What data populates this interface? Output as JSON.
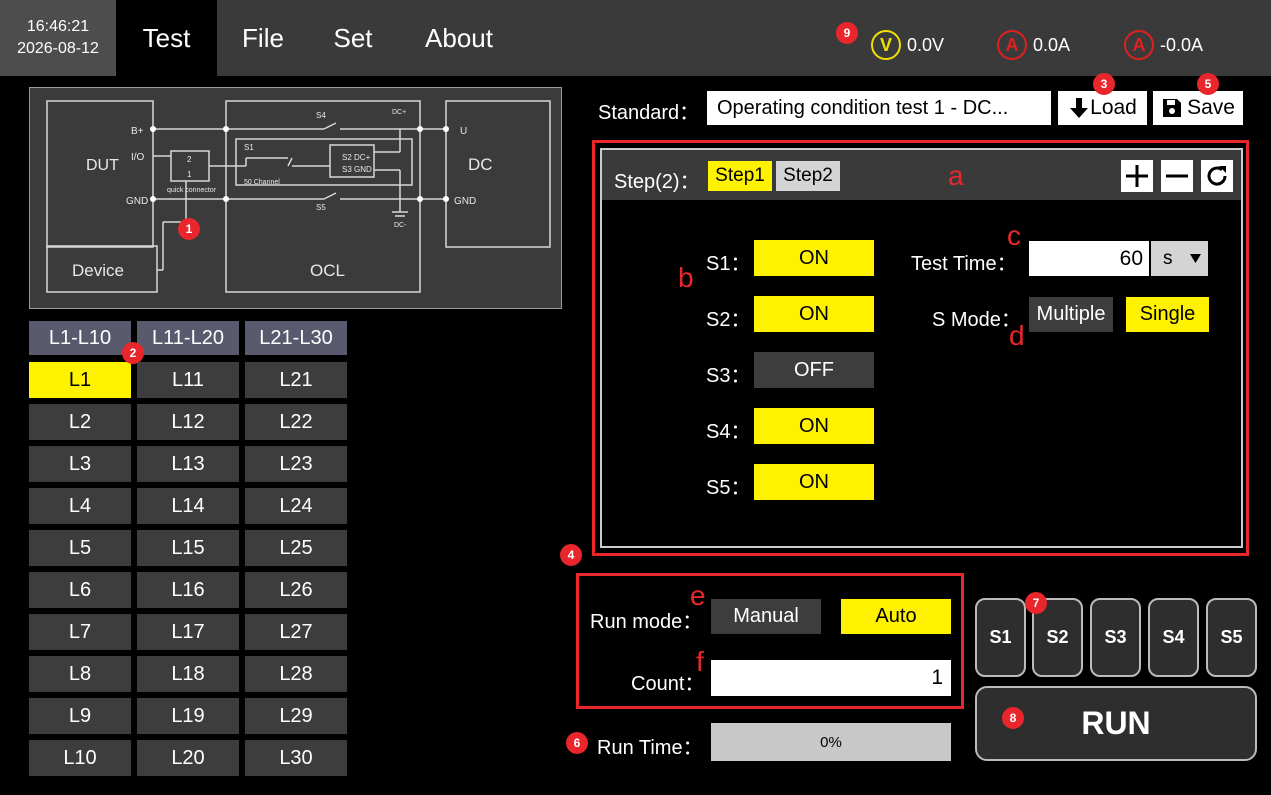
{
  "header": {
    "time": "16:46:21",
    "date": "2026-08-12",
    "menu": [
      "Test",
      "File",
      "Set",
      "About"
    ],
    "meters": {
      "voltage": {
        "symbol": "V",
        "value": "0.0V",
        "color": "#f0e000"
      },
      "current1": {
        "symbol": "A",
        "value": "0.0A",
        "color": "#e02020"
      },
      "current2": {
        "symbol": "A",
        "value": "-0.0A",
        "color": "#e02020"
      }
    }
  },
  "diagram": {
    "dut": "DUT",
    "device": "Device",
    "ocl": "OCL",
    "dc": "DC",
    "bplus": "B+",
    "io": "I/O",
    "gnd_left": "GND",
    "connector_top": "2",
    "connector_bottom": "1",
    "connector_label": "quick connector",
    "s1": "S1",
    "s2": "S2 DC+",
    "s3": "S3 GND",
    "s4": "S4",
    "s5": "S5",
    "channel": "50 Channel",
    "dcplus": "DC+",
    "dcminus": "DC-",
    "u": "U",
    "gnd_right": "GND"
  },
  "levels": {
    "tabs": [
      "L1-L10",
      "L11-L20",
      "L21-L30"
    ],
    "col1": [
      "L1",
      "L2",
      "L3",
      "L4",
      "L5",
      "L6",
      "L7",
      "L8",
      "L9",
      "L10"
    ],
    "col2": [
      "L11",
      "L12",
      "L13",
      "L14",
      "L15",
      "L16",
      "L17",
      "L18",
      "L19",
      "L20"
    ],
    "col3": [
      "L21",
      "L22",
      "L23",
      "L24",
      "L25",
      "L26",
      "L27",
      "L28",
      "L29",
      "L30"
    ],
    "selected": "L1"
  },
  "standard": {
    "label": "Standard：",
    "value": "Operating condition test 1 - DC...",
    "load": "Load",
    "save": "Save"
  },
  "steps": {
    "label": "Step(2)：",
    "tabs": [
      "Step1",
      "Step2"
    ],
    "selected": "Step1",
    "switches": [
      {
        "label": "S1：",
        "state": "ON"
      },
      {
        "label": "S2：",
        "state": "ON"
      },
      {
        "label": "S3：",
        "state": "OFF"
      },
      {
        "label": "S4：",
        "state": "ON"
      },
      {
        "label": "S5：",
        "state": "ON"
      }
    ],
    "test_time_label": "Test Time：",
    "test_time_value": "60",
    "test_time_unit": "s",
    "s_mode_label": "S Mode：",
    "s_mode_options": [
      "Multiple",
      "Single"
    ],
    "s_mode_selected": "Single"
  },
  "run": {
    "mode_label": "Run mode：",
    "modes": [
      "Manual",
      "Auto"
    ],
    "mode_selected": "Auto",
    "count_label": "Count：",
    "count_value": "1",
    "time_label": "Run Time：",
    "progress_text": "0%",
    "progress": 0
  },
  "channels": [
    "S1",
    "S2",
    "S3",
    "S4",
    "S5"
  ],
  "run_button": "RUN",
  "annotations": {
    "badges": [
      "1",
      "2",
      "3",
      "4",
      "5",
      "6",
      "7",
      "8",
      "9"
    ],
    "letters": [
      "a",
      "b",
      "c",
      "d",
      "e",
      "f"
    ]
  },
  "colors": {
    "accent_yellow": "#fff200",
    "annotation_red": "#e8262b",
    "topbar": "#3a3a3a",
    "button_dark": "#3d3d3d"
  }
}
